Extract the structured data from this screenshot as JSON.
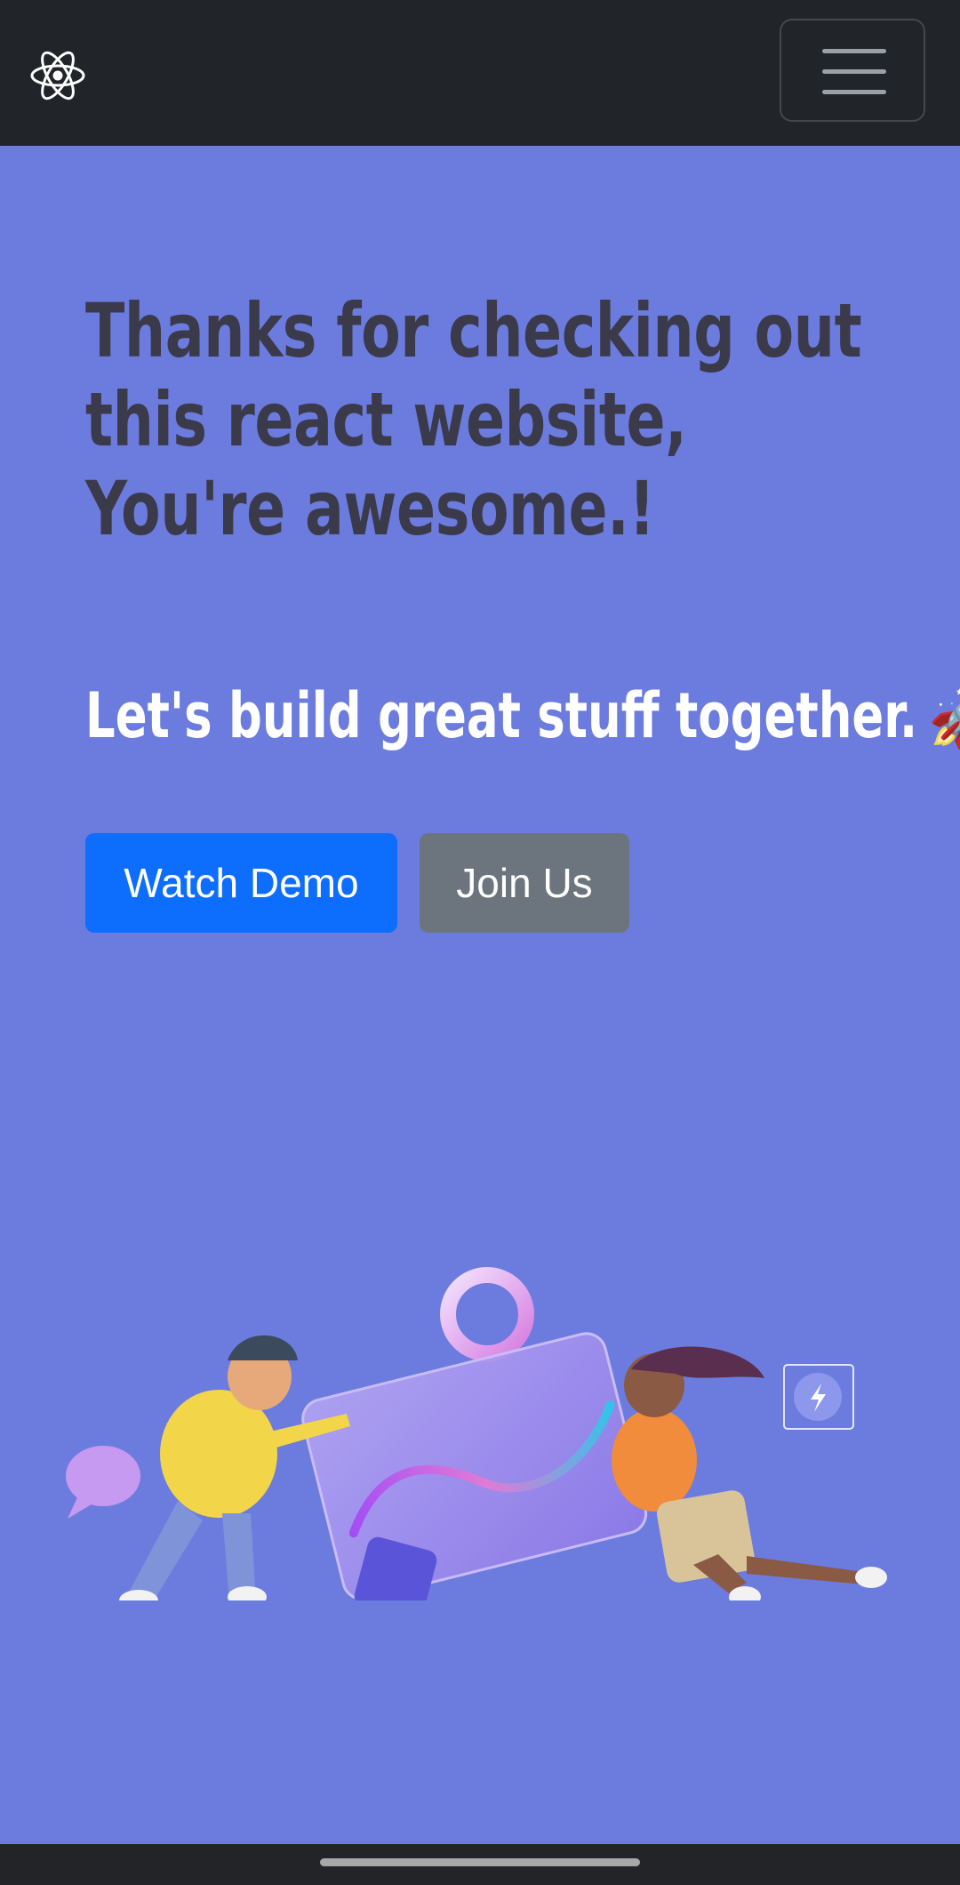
{
  "navbar": {
    "logo_icon": "react-atom-icon",
    "menu_icon": "hamburger-menu-icon",
    "background": "#212529"
  },
  "hero": {
    "background": "#6c7cde",
    "headline": {
      "line1": "Thanks for checking out",
      "line2": "this react website,",
      "line3": "You're awesome.!"
    },
    "tagline": "Let's build great stuff together.",
    "tagline_emoji": "🚀",
    "buttons": {
      "primary_label": "Watch Demo",
      "secondary_label": "Join Us"
    },
    "illustration_icon": "collaboration-illustration"
  },
  "colors": {
    "primary": "#0d6efd",
    "secondary": "#6c757d",
    "headline": "#3b3a4a",
    "tagline": "#ffffff"
  }
}
